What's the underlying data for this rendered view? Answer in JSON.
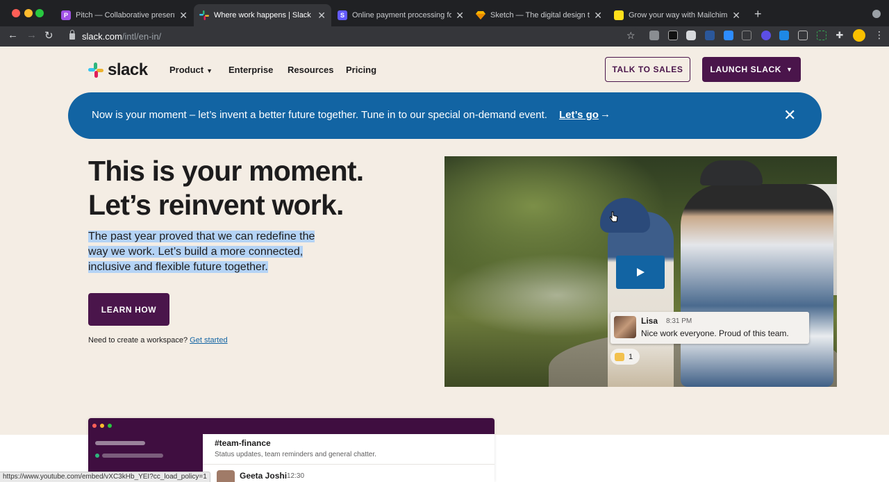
{
  "browser": {
    "tabs": [
      {
        "title": "Pitch — Collaborative presentation software",
        "favicon": "pitch-logo",
        "color": "#a152e6",
        "glyph": "P",
        "active": false
      },
      {
        "title": "Where work happens | Slack",
        "favicon": "slack-logo",
        "color": "#e01e5a",
        "glyph": "",
        "active": true
      },
      {
        "title": "Online payment processing for internet businesses",
        "favicon": "stripe-logo",
        "color": "#635bff",
        "glyph": "S",
        "active": false
      },
      {
        "title": "Sketch — The digital design toolkit",
        "favicon": "sketch-logo",
        "color": "#f7b500",
        "glyph": "",
        "active": false
      },
      {
        "title": "Grow your way with Mailchimp",
        "favicon": "mailchimp-logo",
        "color": "#ffe01b",
        "glyph": "",
        "active": false
      }
    ],
    "url_host": "slack.com",
    "url_path": "/intl/en-in/",
    "status_url": "https://www.youtube.com/embed/vXC3kHb_YEI?cc_load_policy=1"
  },
  "header": {
    "logo_text": "slack",
    "nav": [
      {
        "label": "Product",
        "has_dropdown": true
      },
      {
        "label": "Enterprise",
        "has_dropdown": false
      },
      {
        "label": "Resources",
        "has_dropdown": false
      },
      {
        "label": "Pricing",
        "has_dropdown": false
      }
    ],
    "talk_to_sales": "TALK TO SALES",
    "launch_slack": "LAUNCH SLACK"
  },
  "banner": {
    "text": "Now is your moment – let’s invent a better future together. Tune in to our special on-demand event.",
    "link": "Let’s go",
    "arrow": "→",
    "close": "✕"
  },
  "hero": {
    "title_line1": "This is your moment.",
    "title_line2": "Let’s reinvent work.",
    "subtitle_line1": "The past year proved that we can redefine the",
    "subtitle_line2": "way we work. Let’s build a more connected,",
    "subtitle_line3": "inclusive and flexible future together.",
    "cta": "LEARN HOW",
    "workspace_text": "Need to create a workspace?",
    "workspace_link": "Get started"
  },
  "video": {
    "message_name": "Lisa",
    "message_time": "8:31 PM",
    "message_text": "Nice work everyone. Proud of this team.",
    "reaction_count": "1"
  },
  "preview": {
    "channel": "#team-finance",
    "channel_desc": "Status updates, team reminders and general chatter.",
    "sender": "Geeta Joshi",
    "sender_time": "12:30"
  },
  "colors": {
    "aubergine": "#4a154b",
    "banner_blue": "#1264a3",
    "page_bg": "#f4ede4",
    "selection": "#b4d3f5"
  }
}
